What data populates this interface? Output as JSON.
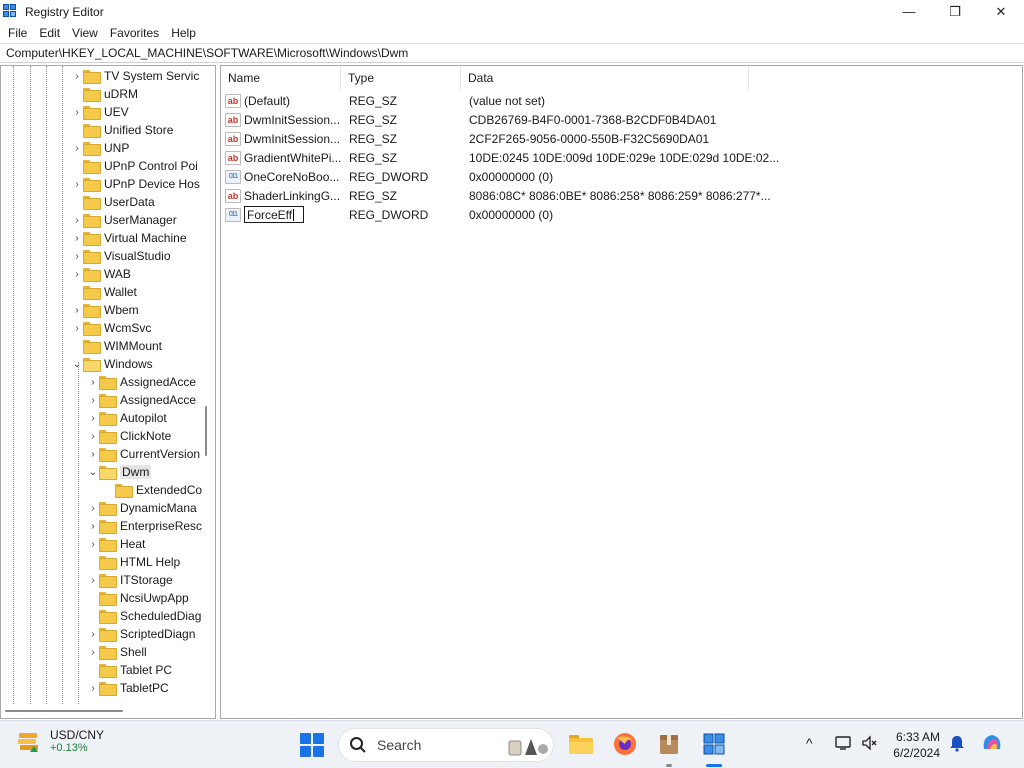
{
  "window": {
    "title": "Registry Editor",
    "minimize": "—",
    "maximize": "❐",
    "close": "✕"
  },
  "menu": [
    "File",
    "Edit",
    "View",
    "Favorites",
    "Help"
  ],
  "address": "Computer\\HKEY_LOCAL_MACHINE\\SOFTWARE\\Microsoft\\Windows\\Dwm",
  "tree": {
    "items": [
      {
        "label": "TV System Servic",
        "expander": "›"
      },
      {
        "label": "uDRM",
        "expander": ""
      },
      {
        "label": "UEV",
        "expander": "›"
      },
      {
        "label": "Unified Store",
        "expander": ""
      },
      {
        "label": "UNP",
        "expander": "›"
      },
      {
        "label": "UPnP Control Poi",
        "expander": ""
      },
      {
        "label": "UPnP Device Hos",
        "expander": "›"
      },
      {
        "label": "UserData",
        "expander": ""
      },
      {
        "label": "UserManager",
        "expander": "›"
      },
      {
        "label": "Virtual Machine",
        "expander": "›"
      },
      {
        "label": "VisualStudio",
        "expander": "›"
      },
      {
        "label": "WAB",
        "expander": "›"
      },
      {
        "label": "Wallet",
        "expander": ""
      },
      {
        "label": "Wbem",
        "expander": "›"
      },
      {
        "label": "WcmSvc",
        "expander": "›"
      },
      {
        "label": "WIMMount",
        "expander": ""
      },
      {
        "label": "Windows",
        "expander": "⌄"
      },
      {
        "label": "AssignedAcce",
        "expander": "›"
      },
      {
        "label": "AssignedAcce",
        "expander": "›"
      },
      {
        "label": "Autopilot",
        "expander": "›"
      },
      {
        "label": "ClickNote",
        "expander": "›"
      },
      {
        "label": "CurrentVersion",
        "expander": "›"
      },
      {
        "label": "Dwm",
        "expander": "⌄"
      },
      {
        "label": "ExtendedCo",
        "expander": ""
      },
      {
        "label": "DynamicMana",
        "expander": "›"
      },
      {
        "label": "EnterpriseResc",
        "expander": "›"
      },
      {
        "label": "Heat",
        "expander": "›"
      },
      {
        "label": "HTML Help",
        "expander": ""
      },
      {
        "label": "ITStorage",
        "expander": "›"
      },
      {
        "label": "NcsiUwpApp",
        "expander": ""
      },
      {
        "label": "ScheduledDiag",
        "expander": ""
      },
      {
        "label": "ScriptedDiagn",
        "expander": "›"
      },
      {
        "label": "Shell",
        "expander": "›"
      },
      {
        "label": "Tablet PC",
        "expander": ""
      },
      {
        "label": "TabletPC",
        "expander": "›"
      }
    ]
  },
  "list": {
    "columns": [
      "Name",
      "Type",
      "Data"
    ],
    "rows": [
      {
        "icon": "ab",
        "name": "(Default)",
        "type": "REG_SZ",
        "data": "(value not set)"
      },
      {
        "icon": "ab",
        "name": "DwmInitSession...",
        "type": "REG_SZ",
        "data": "CDB26769-B4F0-0001-7368-B2CDF0B4DA01"
      },
      {
        "icon": "ab",
        "name": "DwmInitSession...",
        "type": "REG_SZ",
        "data": "2CF2F265-9056-0000-550B-F32C5690DA01"
      },
      {
        "icon": "ab",
        "name": "GradientWhitePi...",
        "type": "REG_SZ",
        "data": "10DE:0245 10DE:009d 10DE:029e 10DE:029d 10DE:02..."
      },
      {
        "icon": "011",
        "name": "OneCoreNoBoo...",
        "type": "REG_DWORD",
        "data": "0x00000000 (0)"
      },
      {
        "icon": "ab",
        "name": "ShaderLinkingG...",
        "type": "REG_SZ",
        "data": "8086:08C* 8086:0BE* 8086:258* 8086:259* 8086:277*..."
      }
    ],
    "editing": {
      "icon": "011",
      "value": "ForceEff",
      "type": "REG_DWORD",
      "data": "0x00000000 (0)"
    }
  },
  "taskbar": {
    "widget": {
      "title": "USD/CNY",
      "change": "+0.13%"
    },
    "search_label": "Search",
    "tray_chevron": "^",
    "clock": {
      "time": "6:33 AM",
      "date": "6/2/2024"
    }
  },
  "colors": {
    "accent": "#1a73e8",
    "folder": "#f5c94a",
    "positive": "#1a7f37"
  }
}
